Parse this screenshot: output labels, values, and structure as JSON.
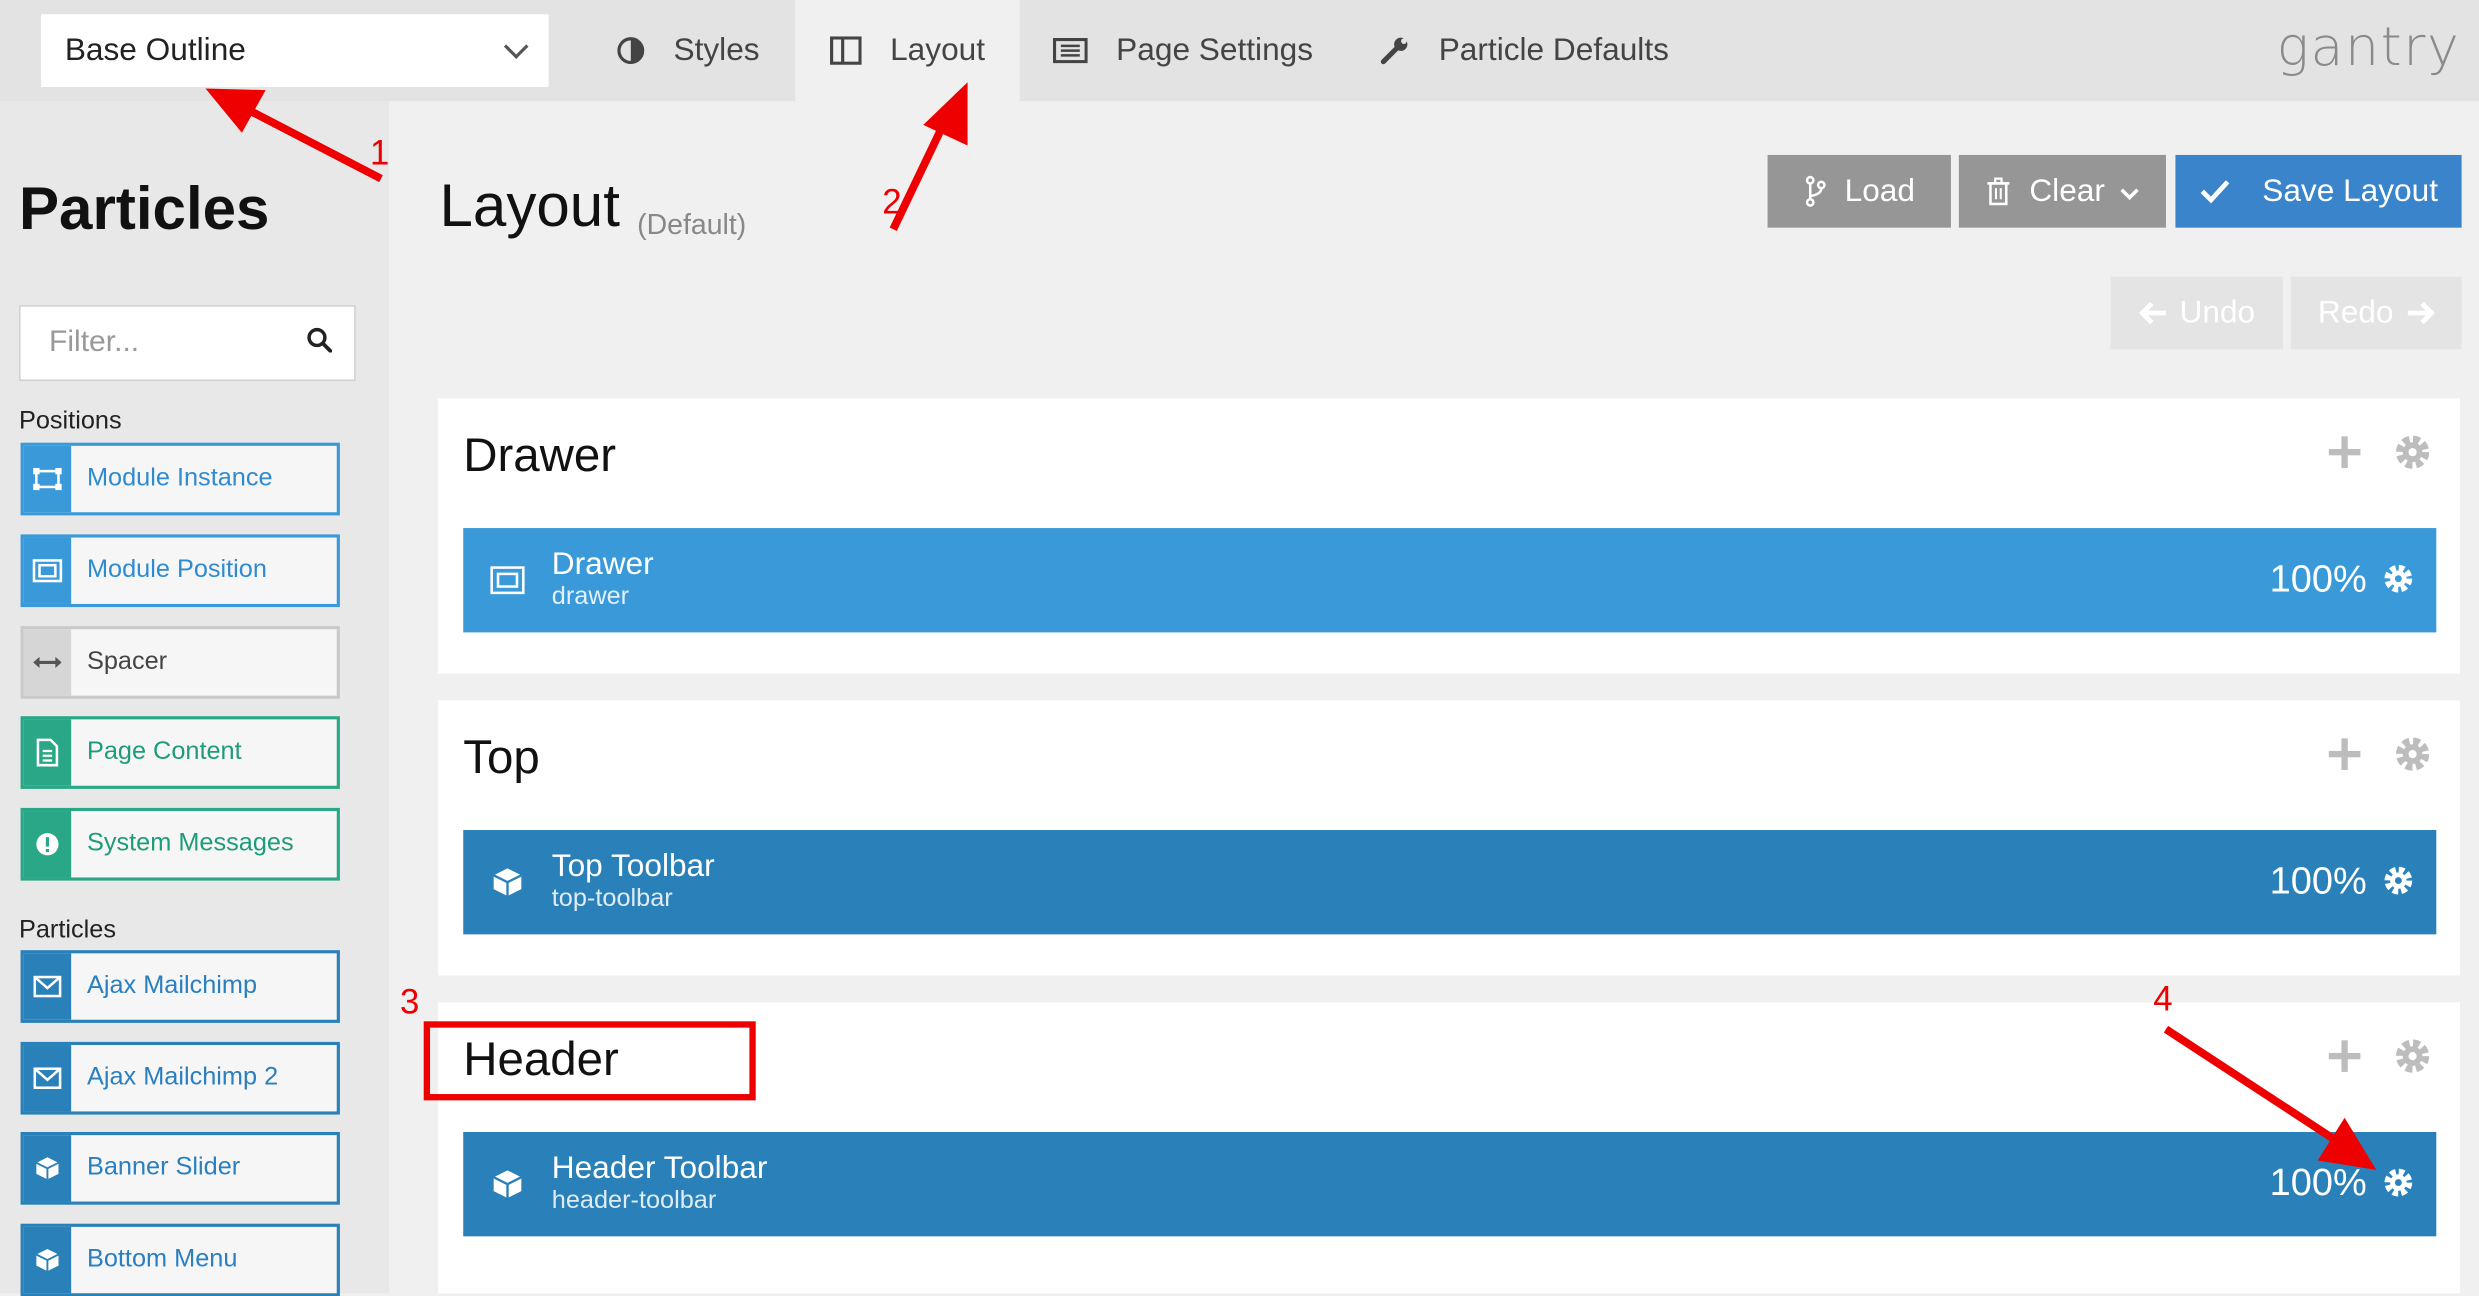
{
  "topbar": {
    "outline": "Base Outline",
    "tabs": [
      {
        "label": "Styles",
        "icon": "contrast-icon"
      },
      {
        "label": "Layout",
        "icon": "columns-icon",
        "active": true
      },
      {
        "label": "Page Settings",
        "icon": "list-icon"
      },
      {
        "label": "Particle Defaults",
        "icon": "wrench-icon"
      }
    ],
    "logo": "gantry"
  },
  "sidebar": {
    "title": "Particles",
    "filter_placeholder": "Filter...",
    "positions_label": "Positions",
    "positions": [
      {
        "label": "Module Instance",
        "icon": "module-instance-icon",
        "style": "blue"
      },
      {
        "label": "Module Position",
        "icon": "module-position-icon",
        "style": "blue"
      },
      {
        "label": "Spacer",
        "icon": "spacer-arrows-icon",
        "style": "gray"
      },
      {
        "label": "Page Content",
        "icon": "document-icon",
        "style": "green"
      },
      {
        "label": "System Messages",
        "icon": "exclamation-icon",
        "style": "green"
      }
    ],
    "particles_label": "Particles",
    "particles": [
      {
        "label": "Ajax Mailchimp",
        "icon": "envelope-icon"
      },
      {
        "label": "Ajax Mailchimp 2",
        "icon": "envelope-icon"
      },
      {
        "label": "Banner Slider",
        "icon": "cube-icon"
      },
      {
        "label": "Bottom Menu",
        "icon": "cube-icon"
      }
    ]
  },
  "main": {
    "title": "Layout",
    "subtitle": "(Default)",
    "load_label": "Load",
    "clear_label": "Clear",
    "save_label": "Save Layout",
    "undo_label": "Undo",
    "redo_label": "Redo",
    "sections": [
      {
        "title": "Drawer",
        "bar": {
          "name": "Drawer",
          "key": "drawer",
          "pct": "100%",
          "style": "light"
        }
      },
      {
        "title": "Top",
        "bar": {
          "name": "Top Toolbar",
          "key": "top-toolbar",
          "pct": "100%",
          "style": "dark"
        }
      },
      {
        "title": "Header",
        "bar": {
          "name": "Header Toolbar",
          "key": "header-toolbar",
          "pct": "100%",
          "style": "dark"
        }
      }
    ]
  },
  "annotations": {
    "n1": "1",
    "n2": "2",
    "n3": "3",
    "n4": "4",
    "color": "#e00000"
  },
  "colors": {
    "primary_blue": "#3a84cc",
    "particle_blue": "#3a9ad9",
    "bar_dark": "#2a80b8",
    "green": "#2aa786",
    "grey_button": "#969696"
  }
}
